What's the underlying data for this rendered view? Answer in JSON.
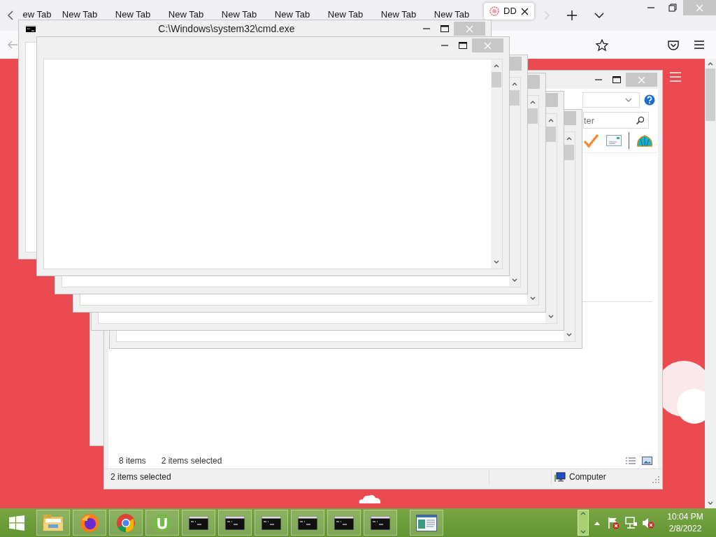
{
  "browser": {
    "tabs": [
      {
        "label": "ew Tab",
        "selected": false
      },
      {
        "label": "New Tab",
        "selected": false
      },
      {
        "label": "New Tab",
        "selected": false
      },
      {
        "label": "New Tab",
        "selected": false
      },
      {
        "label": "New Tab",
        "selected": false
      },
      {
        "label": "New Tab",
        "selected": false
      },
      {
        "label": "New Tab",
        "selected": false
      },
      {
        "label": "New Tab",
        "selected": false
      },
      {
        "label": "New Tab",
        "selected": false
      },
      {
        "label": "DD",
        "selected": true
      }
    ]
  },
  "cmd_windows": [
    {
      "kind": "console",
      "title": "C:\\Windows\\system32\\cmd.exe"
    },
    {
      "kind": "console"
    },
    {
      "kind": "console"
    },
    {
      "kind": "console"
    },
    {
      "kind": "console"
    },
    {
      "kind": "console"
    }
  ],
  "explorer": {
    "search": {
      "placeholder": "ter"
    },
    "item_count": "8 items",
    "selection_count": "2 items selected",
    "status_bar": {
      "selection": "2 items selected",
      "location": "Computer"
    }
  },
  "taskbar": {
    "buttons": [
      {
        "kind": "start"
      },
      {
        "kind": "files"
      },
      {
        "kind": "firefox"
      },
      {
        "kind": "chrome"
      },
      {
        "kind": "torrent"
      },
      {
        "kind": "console"
      },
      {
        "kind": "console"
      },
      {
        "kind": "console"
      },
      {
        "kind": "console"
      },
      {
        "kind": "console"
      },
      {
        "kind": "console"
      },
      {
        "kind": "viewer"
      }
    ],
    "clock": {
      "time": "10:04 PM",
      "date": "2/8/2022"
    }
  }
}
